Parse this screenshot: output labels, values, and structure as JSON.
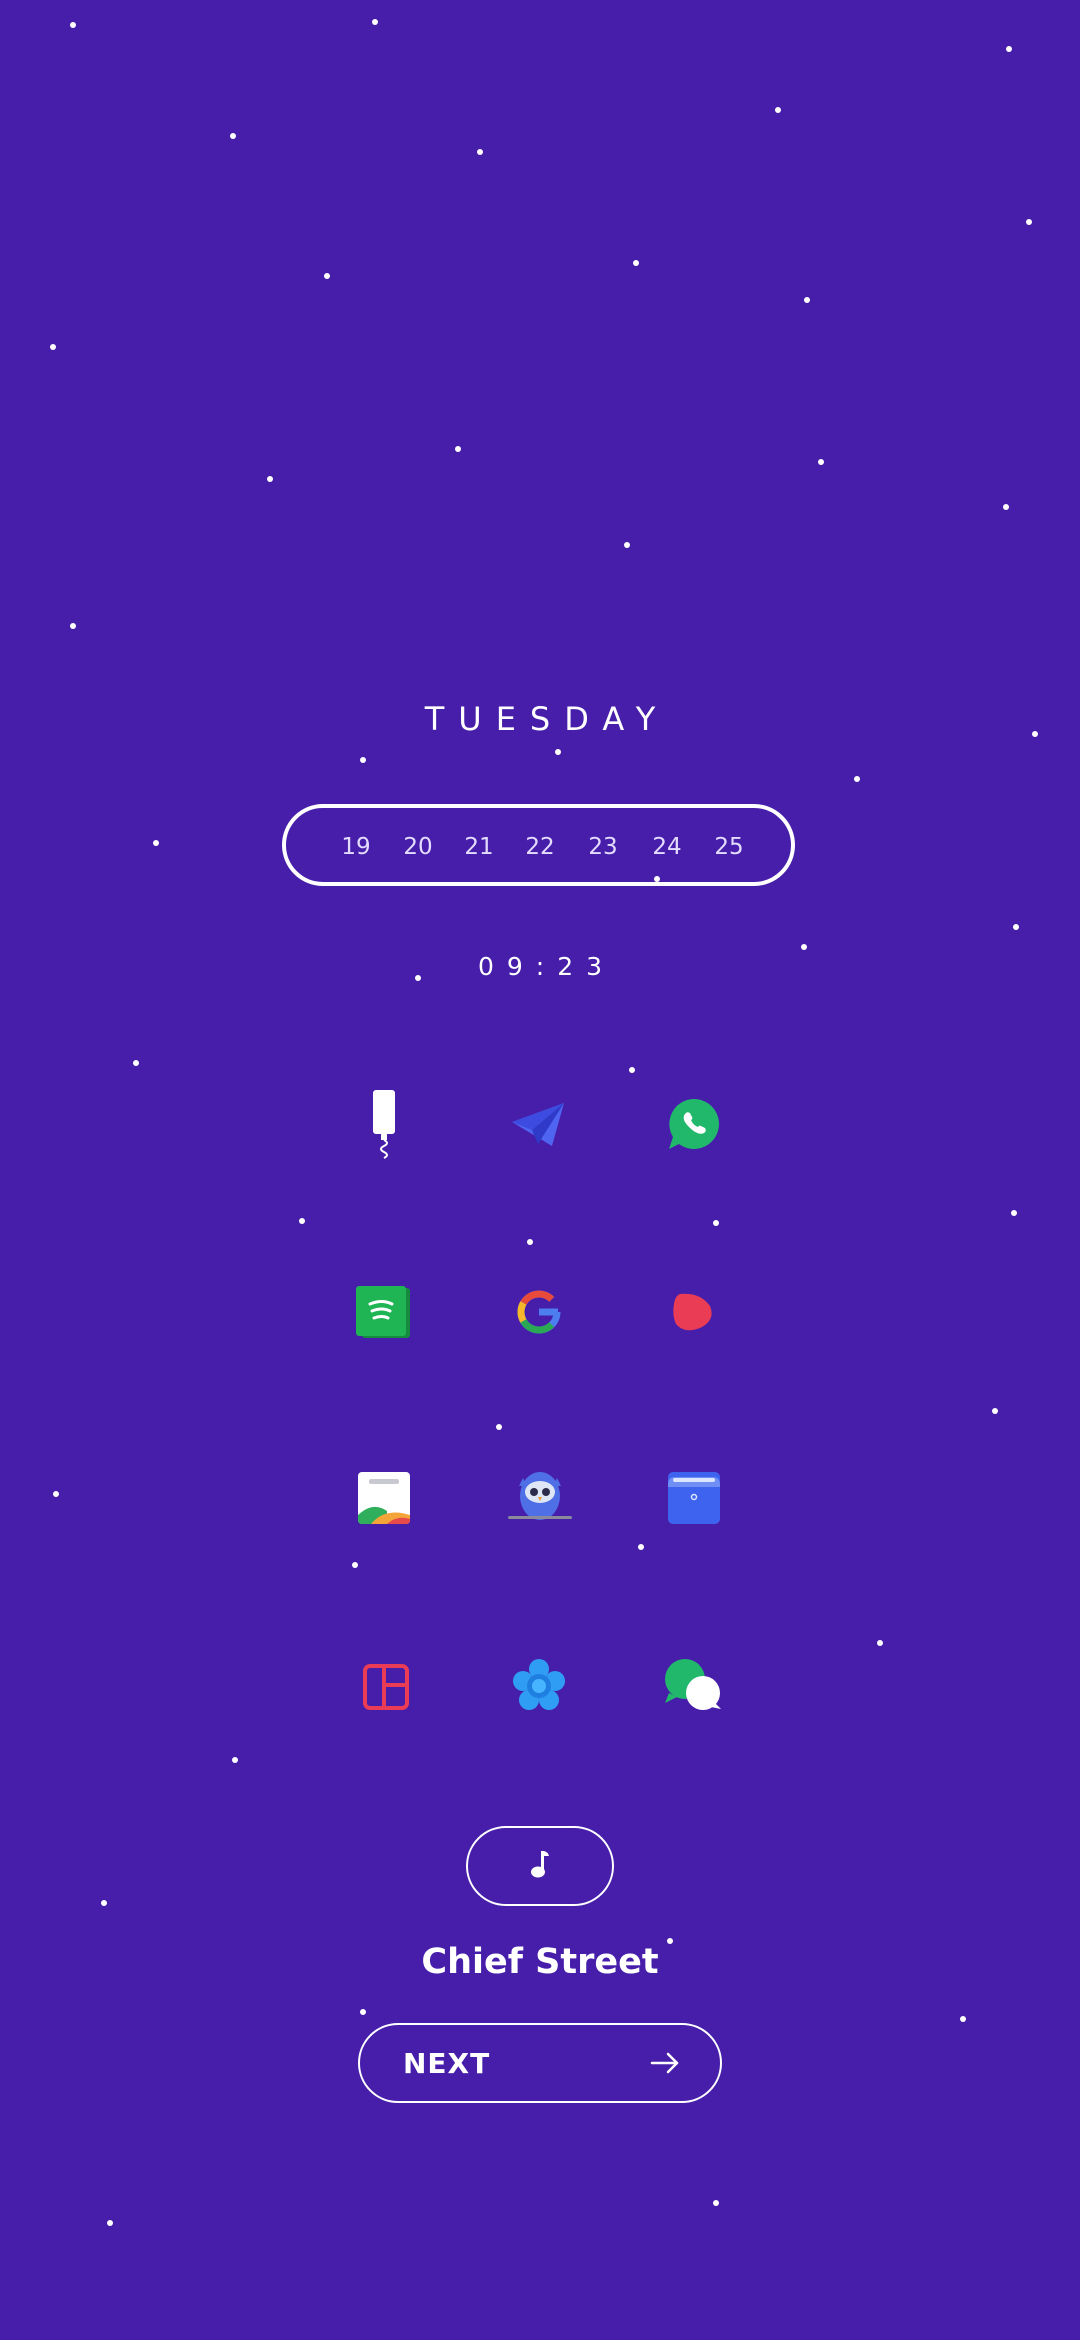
{
  "clock": {
    "day": "TUESDAY",
    "dates": [
      "19",
      "20",
      "21",
      "22",
      "23",
      "24",
      "25"
    ],
    "time": "09:23"
  },
  "apps": [
    {
      "icon": "wine-opener-icon",
      "label": ""
    },
    {
      "icon": "paper-plane-icon",
      "label": ""
    },
    {
      "icon": "phone-chat-icon",
      "label": ""
    },
    {
      "icon": "spotify-icon",
      "label": ""
    },
    {
      "icon": "google-icon",
      "label": ""
    },
    {
      "icon": "red-blob-icon",
      "label": ""
    },
    {
      "icon": "gallery-card-icon",
      "label": ""
    },
    {
      "icon": "owl-icon",
      "label": ""
    },
    {
      "icon": "wallet-icon",
      "label": ""
    },
    {
      "icon": "collage-layout-icon",
      "label": ""
    },
    {
      "icon": "blue-flower-icon",
      "label": ""
    },
    {
      "icon": "chat-bubbles-icon",
      "label": ""
    }
  ],
  "player": {
    "music_icon": "music-note-icon",
    "track": "Chief Street",
    "next_label": "NEXT",
    "next_icon": "arrow-right-icon"
  },
  "colors": {
    "background": "#461eaa",
    "foreground": "#ffffff"
  }
}
